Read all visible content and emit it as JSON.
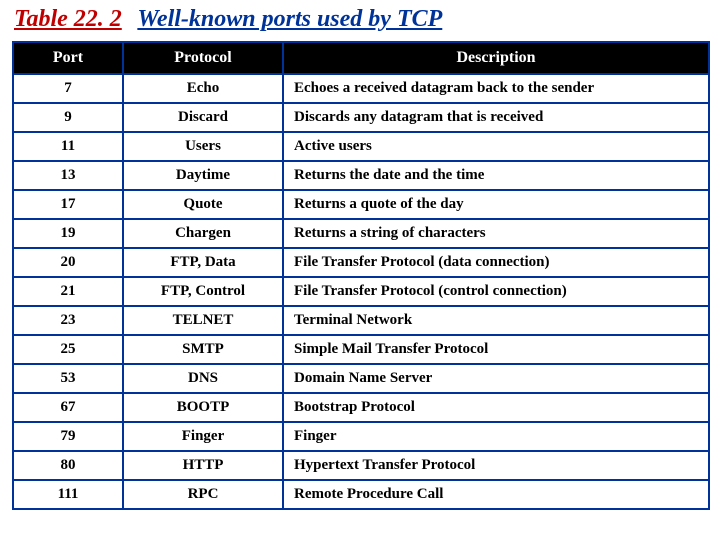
{
  "title": {
    "label": "Table 22. 2",
    "caption": "Well-known ports used by TCP"
  },
  "headers": {
    "port": "Port",
    "protocol": "Protocol",
    "description": "Description"
  },
  "rows": [
    {
      "port": "7",
      "protocol": "Echo",
      "description": "Echoes a received datagram back to the sender"
    },
    {
      "port": "9",
      "protocol": "Discard",
      "description": "Discards any datagram that is received"
    },
    {
      "port": "11",
      "protocol": "Users",
      "description": "Active users"
    },
    {
      "port": "13",
      "protocol": "Daytime",
      "description": "Returns the date and the time"
    },
    {
      "port": "17",
      "protocol": "Quote",
      "description": "Returns a quote of the day"
    },
    {
      "port": "19",
      "protocol": "Chargen",
      "description": "Returns a string of characters"
    },
    {
      "port": "20",
      "protocol": "FTP, Data",
      "description": "File Transfer Protocol (data connection)"
    },
    {
      "port": "21",
      "protocol": "FTP, Control",
      "description": "File Transfer Protocol (control connection)"
    },
    {
      "port": "23",
      "protocol": "TELNET",
      "description": "Terminal Network"
    },
    {
      "port": "25",
      "protocol": "SMTP",
      "description": "Simple Mail Transfer Protocol"
    },
    {
      "port": "53",
      "protocol": "DNS",
      "description": "Domain Name Server"
    },
    {
      "port": "67",
      "protocol": "BOOTP",
      "description": "Bootstrap Protocol"
    },
    {
      "port": "79",
      "protocol": "Finger",
      "description": "Finger"
    },
    {
      "port": "80",
      "protocol": "HTTP",
      "description": "Hypertext Transfer Protocol"
    },
    {
      "port": "111",
      "protocol": "RPC",
      "description": "Remote Procedure Call"
    }
  ]
}
